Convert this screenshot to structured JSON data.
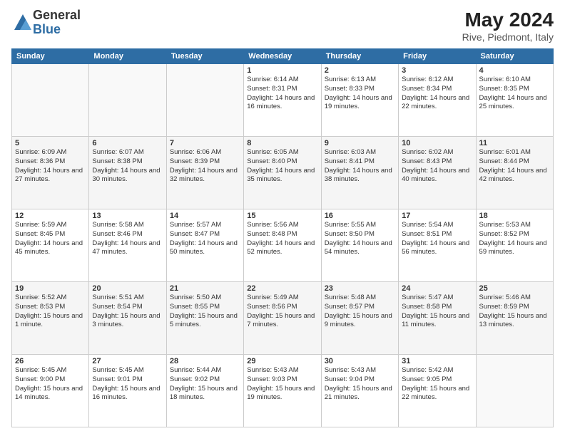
{
  "header": {
    "logo_general": "General",
    "logo_blue": "Blue",
    "title": "May 2024",
    "location": "Rive, Piedmont, Italy"
  },
  "weekdays": [
    "Sunday",
    "Monday",
    "Tuesday",
    "Wednesday",
    "Thursday",
    "Friday",
    "Saturday"
  ],
  "weeks": [
    [
      {
        "day": "",
        "content": ""
      },
      {
        "day": "",
        "content": ""
      },
      {
        "day": "",
        "content": ""
      },
      {
        "day": "1",
        "content": "Sunrise: 6:14 AM\nSunset: 8:31 PM\nDaylight: 14 hours and 16 minutes."
      },
      {
        "day": "2",
        "content": "Sunrise: 6:13 AM\nSunset: 8:33 PM\nDaylight: 14 hours and 19 minutes."
      },
      {
        "day": "3",
        "content": "Sunrise: 6:12 AM\nSunset: 8:34 PM\nDaylight: 14 hours and 22 minutes."
      },
      {
        "day": "4",
        "content": "Sunrise: 6:10 AM\nSunset: 8:35 PM\nDaylight: 14 hours and 25 minutes."
      }
    ],
    [
      {
        "day": "5",
        "content": "Sunrise: 6:09 AM\nSunset: 8:36 PM\nDaylight: 14 hours and 27 minutes."
      },
      {
        "day": "6",
        "content": "Sunrise: 6:07 AM\nSunset: 8:38 PM\nDaylight: 14 hours and 30 minutes."
      },
      {
        "day": "7",
        "content": "Sunrise: 6:06 AM\nSunset: 8:39 PM\nDaylight: 14 hours and 32 minutes."
      },
      {
        "day": "8",
        "content": "Sunrise: 6:05 AM\nSunset: 8:40 PM\nDaylight: 14 hours and 35 minutes."
      },
      {
        "day": "9",
        "content": "Sunrise: 6:03 AM\nSunset: 8:41 PM\nDaylight: 14 hours and 38 minutes."
      },
      {
        "day": "10",
        "content": "Sunrise: 6:02 AM\nSunset: 8:43 PM\nDaylight: 14 hours and 40 minutes."
      },
      {
        "day": "11",
        "content": "Sunrise: 6:01 AM\nSunset: 8:44 PM\nDaylight: 14 hours and 42 minutes."
      }
    ],
    [
      {
        "day": "12",
        "content": "Sunrise: 5:59 AM\nSunset: 8:45 PM\nDaylight: 14 hours and 45 minutes."
      },
      {
        "day": "13",
        "content": "Sunrise: 5:58 AM\nSunset: 8:46 PM\nDaylight: 14 hours and 47 minutes."
      },
      {
        "day": "14",
        "content": "Sunrise: 5:57 AM\nSunset: 8:47 PM\nDaylight: 14 hours and 50 minutes."
      },
      {
        "day": "15",
        "content": "Sunrise: 5:56 AM\nSunset: 8:48 PM\nDaylight: 14 hours and 52 minutes."
      },
      {
        "day": "16",
        "content": "Sunrise: 5:55 AM\nSunset: 8:50 PM\nDaylight: 14 hours and 54 minutes."
      },
      {
        "day": "17",
        "content": "Sunrise: 5:54 AM\nSunset: 8:51 PM\nDaylight: 14 hours and 56 minutes."
      },
      {
        "day": "18",
        "content": "Sunrise: 5:53 AM\nSunset: 8:52 PM\nDaylight: 14 hours and 59 minutes."
      }
    ],
    [
      {
        "day": "19",
        "content": "Sunrise: 5:52 AM\nSunset: 8:53 PM\nDaylight: 15 hours and 1 minute."
      },
      {
        "day": "20",
        "content": "Sunrise: 5:51 AM\nSunset: 8:54 PM\nDaylight: 15 hours and 3 minutes."
      },
      {
        "day": "21",
        "content": "Sunrise: 5:50 AM\nSunset: 8:55 PM\nDaylight: 15 hours and 5 minutes."
      },
      {
        "day": "22",
        "content": "Sunrise: 5:49 AM\nSunset: 8:56 PM\nDaylight: 15 hours and 7 minutes."
      },
      {
        "day": "23",
        "content": "Sunrise: 5:48 AM\nSunset: 8:57 PM\nDaylight: 15 hours and 9 minutes."
      },
      {
        "day": "24",
        "content": "Sunrise: 5:47 AM\nSunset: 8:58 PM\nDaylight: 15 hours and 11 minutes."
      },
      {
        "day": "25",
        "content": "Sunrise: 5:46 AM\nSunset: 8:59 PM\nDaylight: 15 hours and 13 minutes."
      }
    ],
    [
      {
        "day": "26",
        "content": "Sunrise: 5:45 AM\nSunset: 9:00 PM\nDaylight: 15 hours and 14 minutes."
      },
      {
        "day": "27",
        "content": "Sunrise: 5:45 AM\nSunset: 9:01 PM\nDaylight: 15 hours and 16 minutes."
      },
      {
        "day": "28",
        "content": "Sunrise: 5:44 AM\nSunset: 9:02 PM\nDaylight: 15 hours and 18 minutes."
      },
      {
        "day": "29",
        "content": "Sunrise: 5:43 AM\nSunset: 9:03 PM\nDaylight: 15 hours and 19 minutes."
      },
      {
        "day": "30",
        "content": "Sunrise: 5:43 AM\nSunset: 9:04 PM\nDaylight: 15 hours and 21 minutes."
      },
      {
        "day": "31",
        "content": "Sunrise: 5:42 AM\nSunset: 9:05 PM\nDaylight: 15 hours and 22 minutes."
      },
      {
        "day": "",
        "content": ""
      }
    ]
  ]
}
